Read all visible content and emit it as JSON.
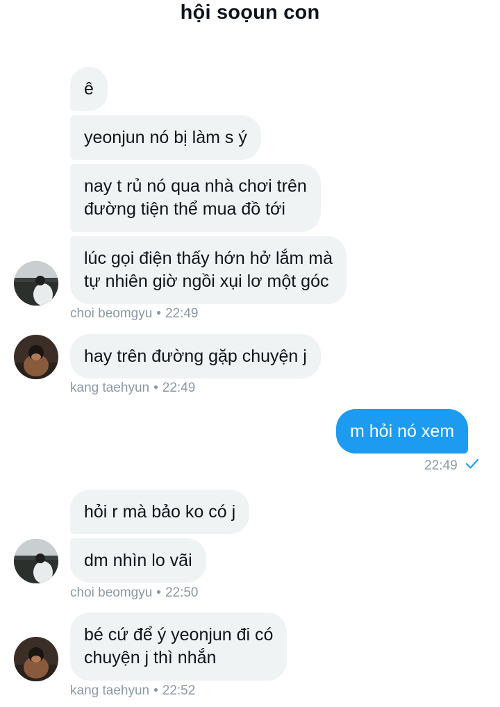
{
  "header": {
    "title": "hội soọun con"
  },
  "messages": [
    {
      "text": "ê"
    },
    {
      "text": "yeonjun nó bị làm s ý"
    },
    {
      "lines": [
        "nay t rủ nó qua nhà chơi trên",
        "đường tiện thể mua đồ tới"
      ]
    },
    {
      "lines": [
        "lúc gọi điện thấy hớn hở lắm mà",
        "tự nhiên giờ ngồi xụi lơ một góc"
      ]
    },
    {
      "text": "hay trên đường gặp chuyện j"
    },
    {
      "text": "m hỏi nó xem"
    },
    {
      "text": "hỏi r mà bảo ko có j"
    },
    {
      "text": "dm nhìn lo vãi"
    },
    {
      "lines": [
        "bé cứ để ý yeonjun đi có",
        "chuyện j thì nhắn"
      ]
    }
  ],
  "meta": [
    {
      "sender": "choi beomgyu",
      "sep": "•",
      "time": "22:49"
    },
    {
      "sender": "kang taehyun",
      "sep": "•",
      "time": "22:49"
    },
    {
      "time": "22:49",
      "status_icon": "check-icon",
      "status_color": "#1d9bf0"
    },
    {
      "sender": "choi beomgyu",
      "sep": "•",
      "time": "22:50"
    },
    {
      "sender": "kang taehyun",
      "sep": "•",
      "time": "22:52"
    }
  ],
  "colors": {
    "incoming_bubble": "#eff3f4",
    "outgoing_bubble": "#1d9bf0",
    "meta_text": "#8b98a5"
  }
}
